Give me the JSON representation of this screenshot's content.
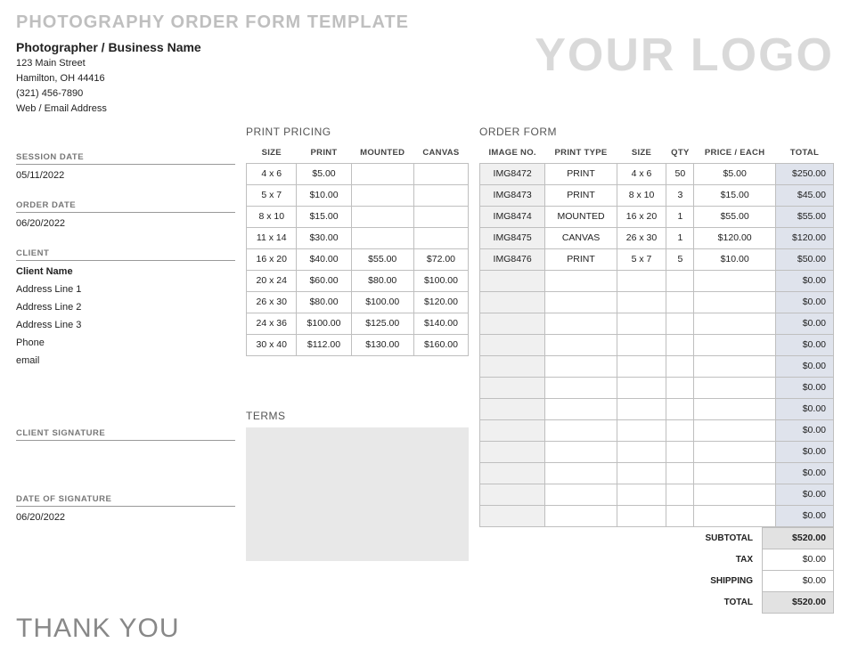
{
  "title": "PHOTOGRAPHY ORDER FORM TEMPLATE",
  "logo_text": "YOUR LOGO",
  "business": {
    "name": "Photographer / Business Name",
    "street": "123 Main Street",
    "city": "Hamilton, OH 44416",
    "phone": "(321) 456-7890",
    "web": "Web / Email Address"
  },
  "left": {
    "session_date_label": "SESSION DATE",
    "session_date": "05/11/2022",
    "order_date_label": "ORDER DATE",
    "order_date": "06/20/2022",
    "client_label": "CLIENT",
    "client_name": "Client Name",
    "addr1": "Address Line 1",
    "addr2": "Address Line 2",
    "addr3": "Address Line 3",
    "phone": "Phone",
    "email": "email",
    "signature_label": "CLIENT SIGNATURE",
    "date_signature_label": "DATE OF SIGNATURE",
    "date_signature": "06/20/2022",
    "thank_you": "THANK YOU"
  },
  "pricing": {
    "title": "PRINT PRICING",
    "headers": {
      "size": "SIZE",
      "print": "PRINT",
      "mounted": "MOUNTED",
      "canvas": "CANVAS"
    },
    "rows": [
      {
        "size": "4 x 6",
        "print": "$5.00",
        "mounted": "",
        "canvas": ""
      },
      {
        "size": "5 x 7",
        "print": "$10.00",
        "mounted": "",
        "canvas": ""
      },
      {
        "size": "8 x 10",
        "print": "$15.00",
        "mounted": "",
        "canvas": ""
      },
      {
        "size": "11 x 14",
        "print": "$30.00",
        "mounted": "",
        "canvas": ""
      },
      {
        "size": "16 x 20",
        "print": "$40.00",
        "mounted": "$55.00",
        "canvas": "$72.00"
      },
      {
        "size": "20 x 24",
        "print": "$60.00",
        "mounted": "$80.00",
        "canvas": "$100.00"
      },
      {
        "size": "26 x 30",
        "print": "$80.00",
        "mounted": "$100.00",
        "canvas": "$120.00"
      },
      {
        "size": "24 x 36",
        "print": "$100.00",
        "mounted": "$125.00",
        "canvas": "$140.00"
      },
      {
        "size": "30 x 40",
        "print": "$112.00",
        "mounted": "$130.00",
        "canvas": "$160.00"
      }
    ],
    "terms_label": "TERMS"
  },
  "order": {
    "title": "ORDER FORM",
    "headers": {
      "img": "IMAGE NO.",
      "type": "PRINT TYPE",
      "size": "SIZE",
      "qty": "QTY",
      "price": "PRICE / EACH",
      "total": "TOTAL"
    },
    "rows": [
      {
        "img": "IMG8472",
        "type": "PRINT",
        "size": "4 x 6",
        "qty": "50",
        "price": "$5.00",
        "total": "$250.00"
      },
      {
        "img": "IMG8473",
        "type": "PRINT",
        "size": "8 x 10",
        "qty": "3",
        "price": "$15.00",
        "total": "$45.00"
      },
      {
        "img": "IMG8474",
        "type": "MOUNTED",
        "size": "16 x 20",
        "qty": "1",
        "price": "$55.00",
        "total": "$55.00"
      },
      {
        "img": "IMG8475",
        "type": "CANVAS",
        "size": "26 x 30",
        "qty": "1",
        "price": "$120.00",
        "total": "$120.00"
      },
      {
        "img": "IMG8476",
        "type": "PRINT",
        "size": "5 x 7",
        "qty": "5",
        "price": "$10.00",
        "total": "$50.00"
      }
    ],
    "empty_total": "$0.00",
    "empty_count": 12,
    "summary": {
      "subtotal_label": "SUBTOTAL",
      "subtotal": "$520.00",
      "tax_label": "TAX",
      "tax": "$0.00",
      "shipping_label": "SHIPPING",
      "shipping": "$0.00",
      "total_label": "TOTAL",
      "total": "$520.00"
    }
  }
}
